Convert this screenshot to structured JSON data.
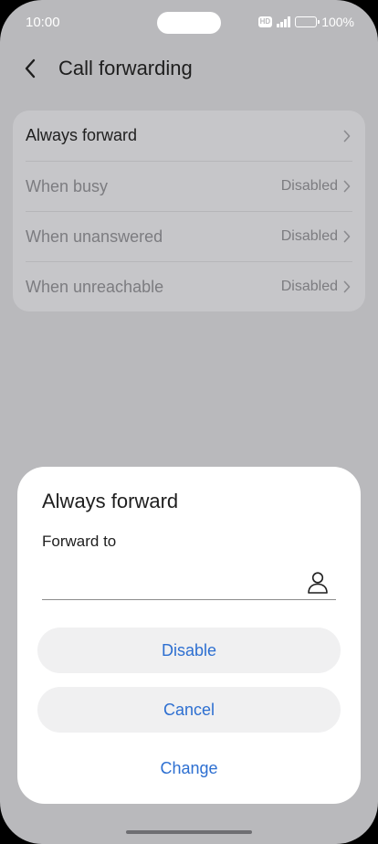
{
  "status_bar": {
    "time": "10:00",
    "network_badge": "HD",
    "battery": "100%",
    "battery_level": 1.0
  },
  "header": {
    "title": "Call forwarding",
    "back_icon": "chevron-left-icon"
  },
  "list": {
    "items": [
      {
        "label": "Always forward",
        "value": ""
      },
      {
        "label": "When busy",
        "value": "Disabled"
      },
      {
        "label": "When unanswered",
        "value": "Disabled"
      },
      {
        "label": "When unreachable",
        "value": "Disabled"
      }
    ]
  },
  "dialog": {
    "title": "Always forward",
    "field_label": "Forward to",
    "field_value": "",
    "contact_icon": "contact-person-icon",
    "buttons": {
      "disable": "Disable",
      "cancel": "Cancel",
      "change": "Change"
    }
  },
  "colors": {
    "accent": "#2d6fd1",
    "scrim": "#b9b9bc"
  }
}
